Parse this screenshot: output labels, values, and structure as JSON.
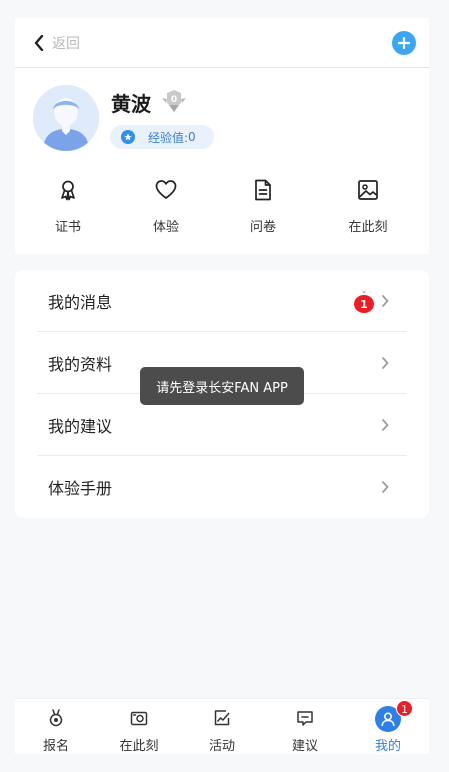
{
  "nav": {
    "back_label": "返回"
  },
  "profile": {
    "name": "黄波",
    "level": "0",
    "exp_label": "经验值:",
    "exp_value": "0"
  },
  "shortcuts": [
    {
      "label": "证书",
      "icon": "certificate-icon"
    },
    {
      "label": "体验",
      "icon": "heart-icon"
    },
    {
      "label": "问卷",
      "icon": "document-icon"
    },
    {
      "label": "在此刻",
      "icon": "image-icon"
    }
  ],
  "menu": [
    {
      "label": "我的消息",
      "badge": "1"
    },
    {
      "label": "我的资料"
    },
    {
      "label": "我的建议"
    },
    {
      "label": "体验手册"
    }
  ],
  "toast": {
    "text": "请先登录长安FAN APP"
  },
  "tabs": [
    {
      "label": "报名",
      "icon": "medal-icon"
    },
    {
      "label": "在此刻",
      "icon": "camera-icon"
    },
    {
      "label": "活动",
      "icon": "activity-icon"
    },
    {
      "label": "建议",
      "icon": "message-icon"
    },
    {
      "label": "我的",
      "icon": "user-icon",
      "badge": "1",
      "active": true
    }
  ],
  "colors": {
    "accent": "#2f7fe8",
    "badge": "#ee1c25",
    "plus": "#3aa7f5"
  }
}
